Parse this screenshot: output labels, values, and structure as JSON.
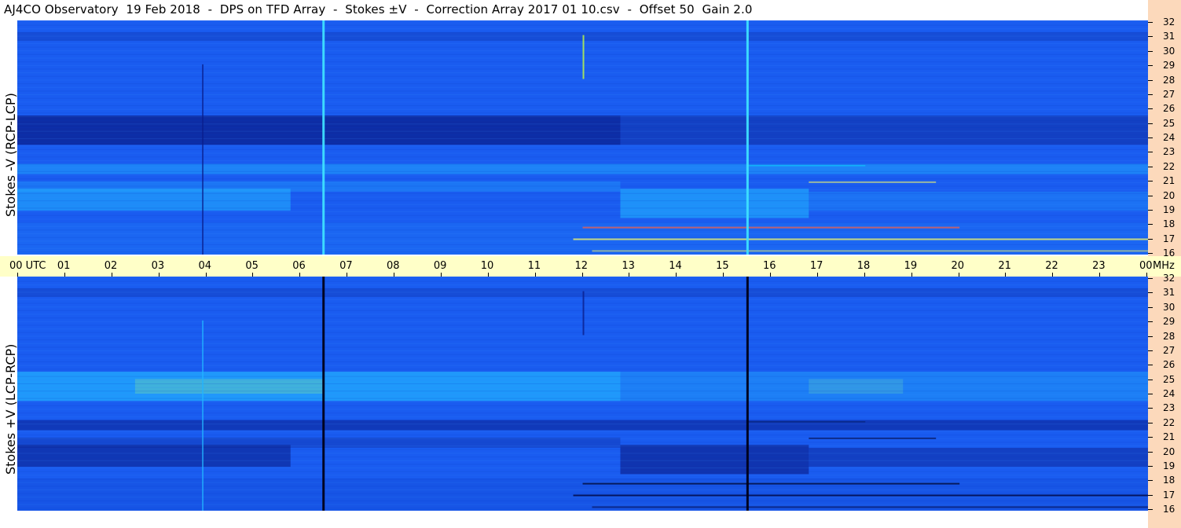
{
  "title": "AJ4CO Observatory  19 Feb 2018  -  DPS on TFD Array  -  Stokes ±V  -  Correction Array 2017 01 10.csv  -  Offset 50  Gain 2.0",
  "panels": [
    {
      "ylabel": "Stokes -V (RCP-LCP)",
      "polarity": "negative"
    },
    {
      "ylabel": "Stokes +V (LCP-RCP)",
      "polarity": "positive"
    }
  ],
  "time_axis": {
    "labels": [
      "00 UTC",
      "01",
      "02",
      "03",
      "04",
      "05",
      "06",
      "07",
      "08",
      "09",
      "10",
      "11",
      "12",
      "13",
      "14",
      "15",
      "16",
      "17",
      "18",
      "19",
      "20",
      "21",
      "22",
      "23",
      "00"
    ],
    "unit": "MHz"
  },
  "freq_axis": {
    "labels": [
      "32",
      "31",
      "30",
      "29",
      "28",
      "27",
      "26",
      "25",
      "24",
      "23",
      "22",
      "21",
      "20",
      "19",
      "18",
      "17",
      "16"
    ]
  },
  "colors": {
    "background_base": "#1a5cf0",
    "dark_band": "#0a1e8c",
    "light_band": "#22b4ff",
    "hot": "#ffff60",
    "time_axis_bg": "#ffffc8",
    "freq_axis_bg": "#fcd9bb"
  },
  "chart_data": {
    "type": "heatmap",
    "title": "AJ4CO Observatory  19 Feb 2018  -  DPS on TFD Array  -  Stokes ±V  -  Correction Array 2017 01 10.csv  -  Offset 50  Gain 2.0",
    "xlabel": "UTC",
    "ylabel": "MHz",
    "xlim": [
      0,
      24
    ],
    "ylim": [
      16,
      32
    ],
    "x_ticks": [
      "00 UTC",
      "01",
      "02",
      "03",
      "04",
      "05",
      "06",
      "07",
      "08",
      "09",
      "10",
      "11",
      "12",
      "13",
      "14",
      "15",
      "16",
      "17",
      "18",
      "19",
      "20",
      "21",
      "22",
      "23",
      "00"
    ],
    "y_ticks": [
      32,
      31,
      30,
      29,
      28,
      27,
      26,
      25,
      24,
      23,
      22,
      21,
      20,
      19,
      18,
      17,
      16
    ],
    "series": [
      {
        "name": "Stokes -V (RCP-LCP)"
      },
      {
        "name": "Stokes +V (LCP-RCP)"
      }
    ],
    "features": {
      "calibration_lines_utc": [
        6.5,
        15.5
      ],
      "step_changes_utc": [
        5.8,
        12.8,
        16.8
      ],
      "rfi_band_start_utc": 11.8,
      "strong_band_mhz": [
        23.5,
        25.5
      ],
      "weak_band_mhz": [
        19.0,
        20.5
      ]
    }
  }
}
